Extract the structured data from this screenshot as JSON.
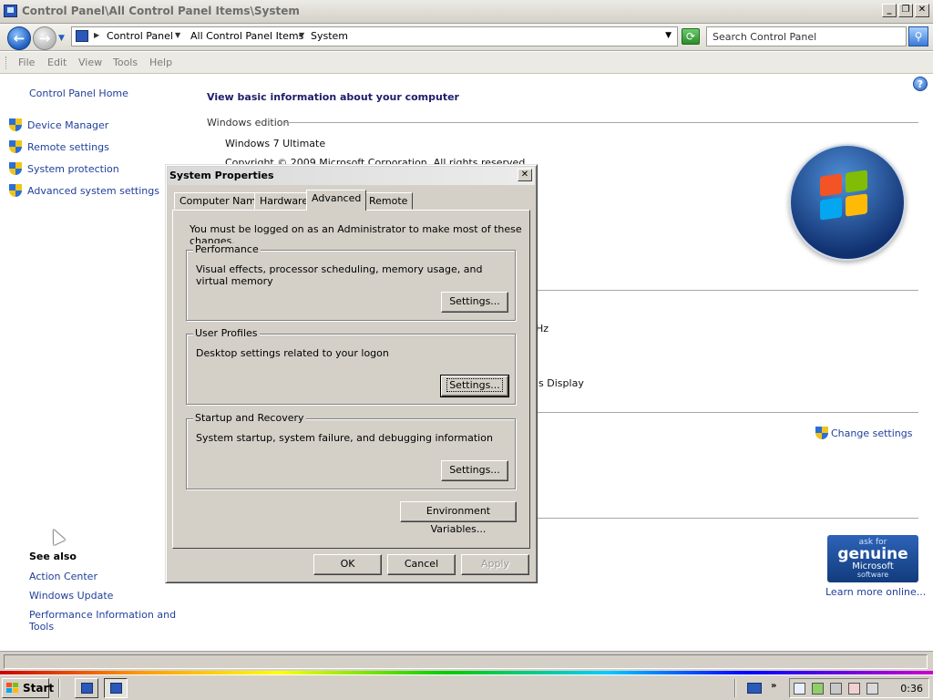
{
  "window": {
    "title": "Control Panel\\All Control Panel Items\\System"
  },
  "address": {
    "crumbs": [
      "Control Panel",
      "All Control Panel Items",
      "System"
    ],
    "search_placeholder": "Search Control Panel"
  },
  "menu": [
    "File",
    "Edit",
    "View",
    "Tools",
    "Help"
  ],
  "left_pane": {
    "home": "Control Panel Home",
    "tasks": [
      "Device Manager",
      "Remote settings",
      "System protection",
      "Advanced system settings"
    ],
    "see_also_title": "See also",
    "see_also": [
      "Action Center",
      "Windows Update",
      "Performance Information and",
      "Tools"
    ]
  },
  "main": {
    "heading": "View basic information about your computer",
    "windows_edition_label": "Windows edition",
    "edition": "Windows 7 Ultimate",
    "copyright": "Copyright © 2009 Microsoft Corporation.  All rights reserved.",
    "partial_hz": "Hz",
    "partial_display": "is Display",
    "change_settings": "Change settings",
    "genuine": {
      "ask_for": "ask for",
      "genuine": "genuine",
      "microsoft": "Microsoft",
      "software": "software"
    },
    "learn_more": "Learn more online..."
  },
  "dialog": {
    "title": "System Properties",
    "tabs": [
      "Computer Name",
      "Hardware",
      "Advanced",
      "Remote"
    ],
    "active_tab": "Advanced",
    "admin_note": "You must be logged on as an Administrator to make most of these changes.",
    "groups": [
      {
        "label": "Performance",
        "desc": "Visual effects, processor scheduling, memory usage, and virtual memory",
        "button": "Settings..."
      },
      {
        "label": "User Profiles",
        "desc": "Desktop settings related to your logon",
        "button": "Settings..."
      },
      {
        "label": "Startup and Recovery",
        "desc": "System startup, system failure, and debugging information",
        "button": "Settings..."
      }
    ],
    "env_button": "Environment Variables...",
    "ok": "OK",
    "cancel": "Cancel",
    "apply": "Apply"
  },
  "taskbar": {
    "start": "Start",
    "clock": "0:36"
  },
  "colors": {
    "link": "#1f3f9b",
    "dialog_face": "#d4d0c8"
  }
}
